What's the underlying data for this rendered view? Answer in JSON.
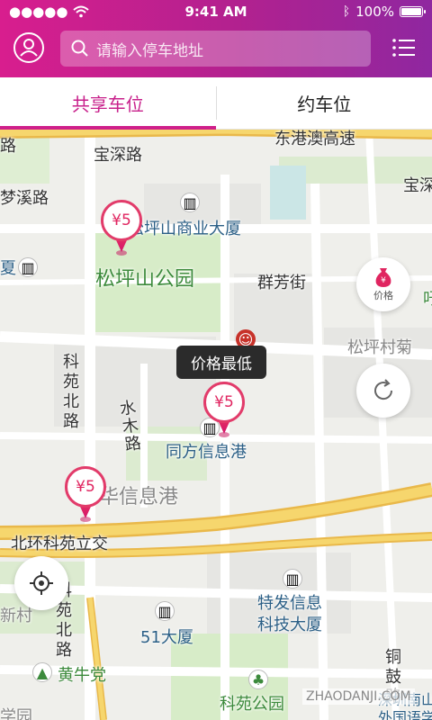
{
  "status_bar": {
    "time": "9:41 AM",
    "battery": "100%"
  },
  "header": {
    "search_placeholder": "请输入停车地址"
  },
  "tabs": [
    {
      "label": "共享车位",
      "active": true
    },
    {
      "label": "约车位",
      "active": false
    }
  ],
  "map": {
    "labels": {
      "road_top_left": "路",
      "baoshen_road": "宝深路",
      "dongbin_expressway": "东港澳高速",
      "baoshen_right": "宝深",
      "mengxi_road": "梦溪路",
      "songping_building": "松坪山商业大厦",
      "songping_park": "松坪山公园",
      "xia_left": "夏",
      "qunfang_street": "群芳街",
      "kou_right": "吁",
      "songping_village": "松坪村菊",
      "keyuan_north_road": "科苑北路",
      "shuimu_road": "水木路",
      "tongfang": "同方信息港",
      "huaxin": "华信息港",
      "beihuan": "北环科苑立交",
      "keyuan_north_road_2": "科苑北路",
      "xincun": "新村",
      "tefa": "特发信息",
      "tefa_2": "科技大厦",
      "dasha_51": "51大厦",
      "tonggu_road": "铜鼓路",
      "huangniu": "黄牛党",
      "keyuan_park": "科苑公园",
      "shenzhen_south": "深圳南山",
      "foreign_lang": "外国语学",
      "xuyuan": "学园"
    },
    "pins": [
      {
        "price": "¥5"
      },
      {
        "price": "¥5"
      },
      {
        "price": "¥5"
      }
    ],
    "tooltip": "价格最低",
    "price_button_label": "价格",
    "watermark": "ZHAODANJI.COM"
  },
  "colors": {
    "brand_pink": "#d81e8e",
    "brand_purple": "#8f27a0",
    "pin_red": "#e23b6a",
    "road_yellow": "#f2c84b"
  }
}
